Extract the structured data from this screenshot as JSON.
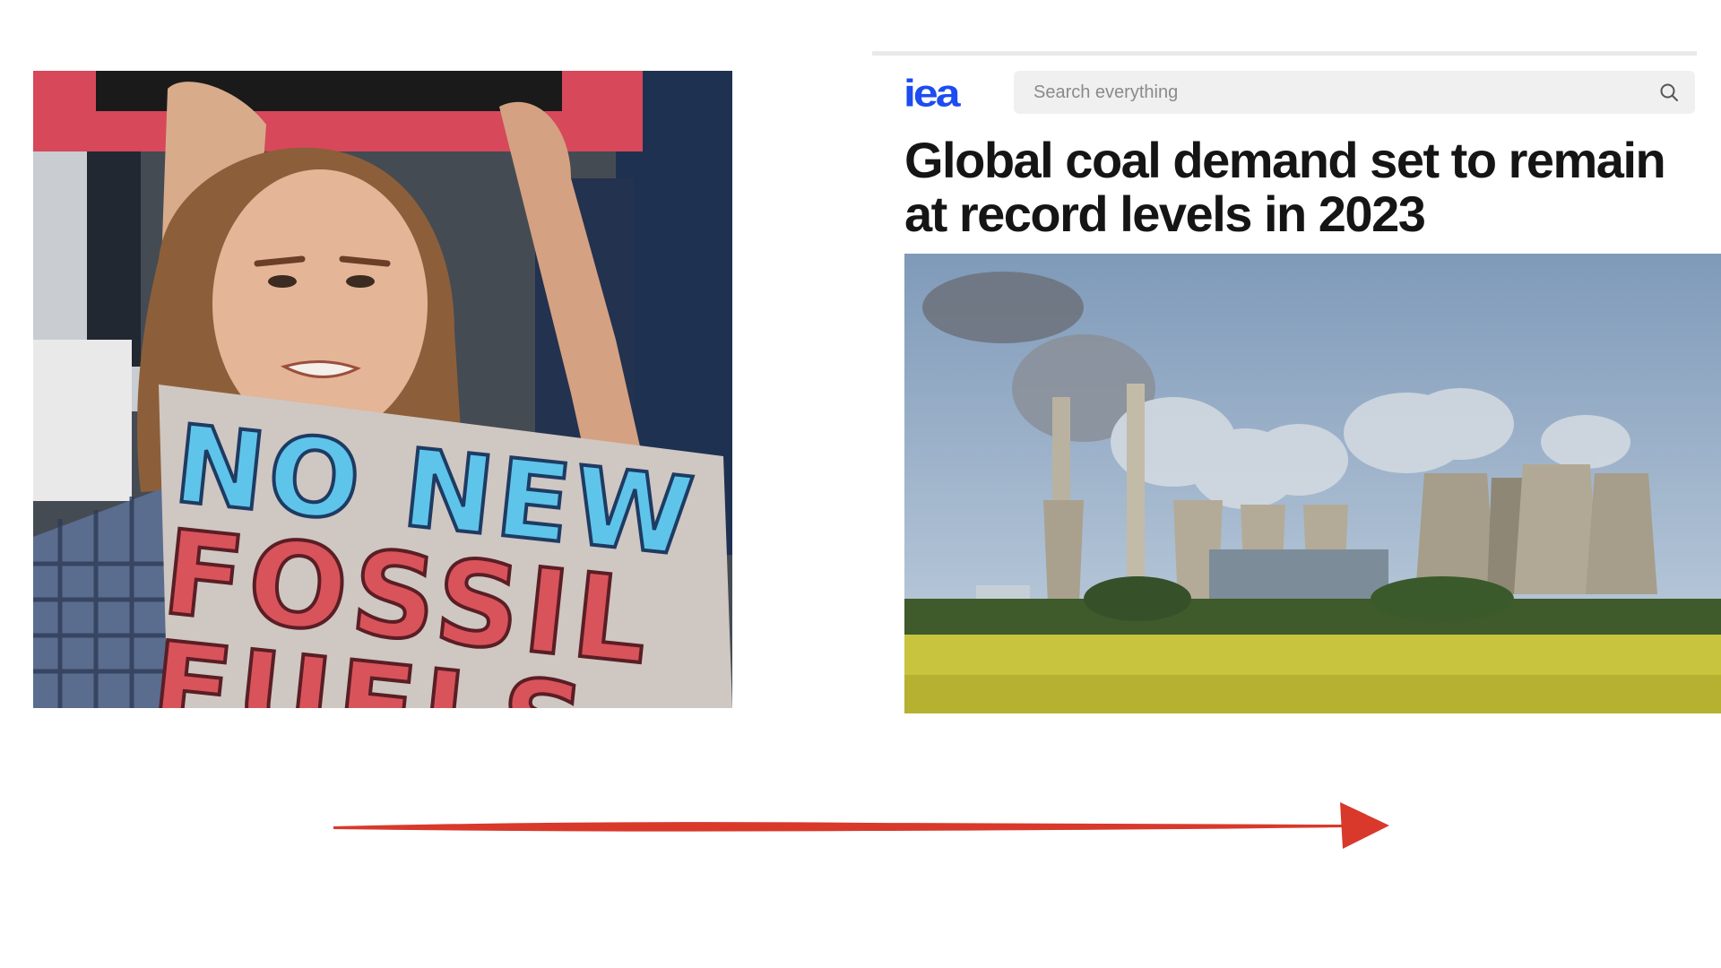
{
  "left_photo": {
    "sign_line_1": "NO NEW",
    "sign_line_2": "FOSSIL",
    "sign_line_3": "FUELS",
    "icon": "protest-photo"
  },
  "iea_page": {
    "logo": "iea",
    "search": {
      "placeholder": "Search everything",
      "icon": "search-icon"
    },
    "headline": "Global coal demand set to remain at record levels in 2023",
    "photo_icon": "power-plant-photo"
  },
  "arrow": {
    "color": "#d8392b",
    "icon": "arrow-right-icon"
  },
  "colors": {
    "iea_blue": "#1d4cf0",
    "sign_blue": "#5fc4ea",
    "sign_red": "#d9535b"
  }
}
